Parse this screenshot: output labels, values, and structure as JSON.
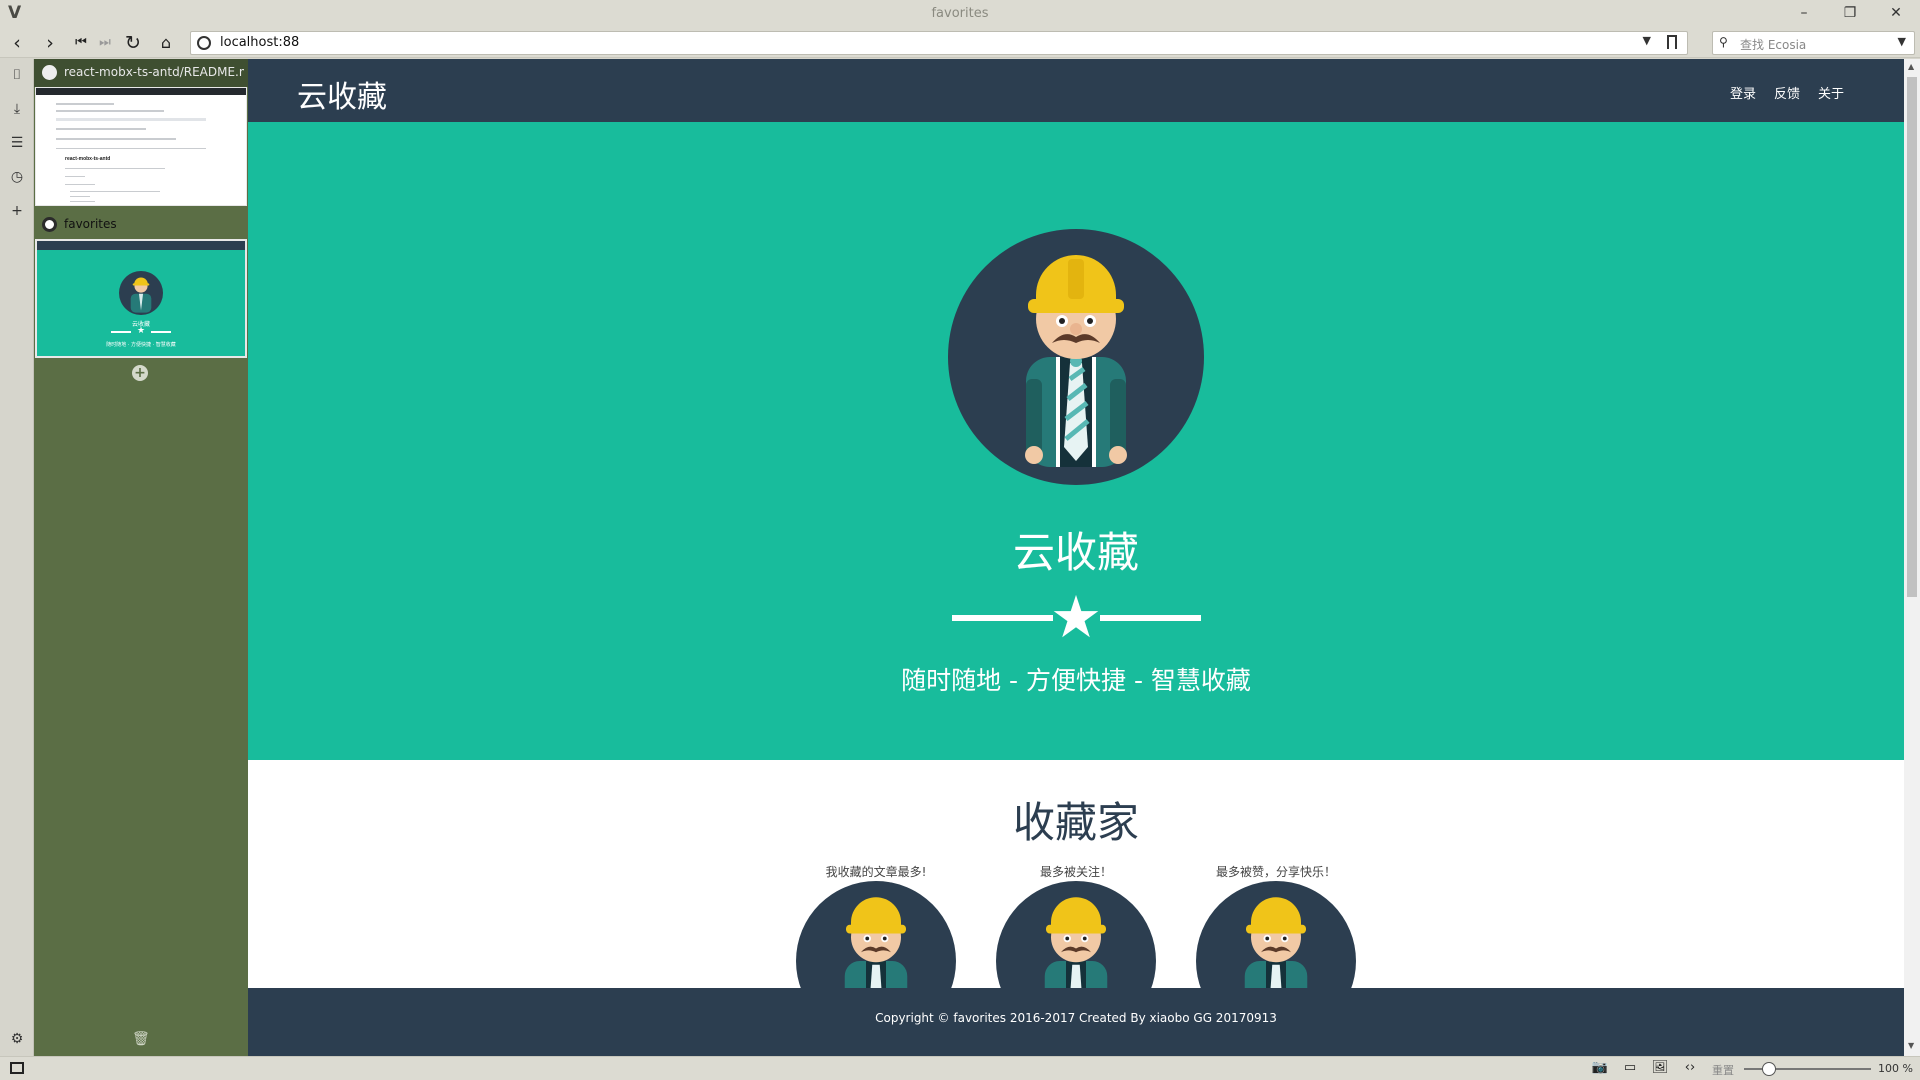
{
  "window": {
    "title": "favorites"
  },
  "addressbar": {
    "url": "localhost:88",
    "search_placeholder": "查找 Ecosia"
  },
  "tabs": [
    {
      "title": "react-mobx-ts-antd/README.md",
      "thumb_heading": "react-mobx-ts-antd"
    },
    {
      "title": "favorites",
      "thumb_title": "云收藏",
      "thumb_sub": "随时随地 · 方便快捷 · 智慧收藏"
    }
  ],
  "site": {
    "brand": "云收藏",
    "nav": [
      "登录",
      "反馈",
      "关于"
    ],
    "hero": {
      "title": "云收藏",
      "subtitle": "随时随地 - 方便快捷 - 智慧收藏"
    },
    "collectors": {
      "title": "收藏家",
      "items": [
        {
          "caption": "我收藏的文章最多!"
        },
        {
          "caption": "最多被关注！"
        },
        {
          "caption": "最多被赞，分享快乐！"
        }
      ]
    },
    "footer": "Copyright © favorites 2016-2017 Created By xiaobo GG 20170913"
  },
  "statusbar": {
    "reset_label": "重置",
    "zoom": "100 %",
    "zoom_level_percent": 100
  },
  "colors": {
    "hero": "#18bc9c",
    "navbar": "#2c3e50",
    "tabpanel": "#5b6e45",
    "helmet": "#f0c419"
  }
}
